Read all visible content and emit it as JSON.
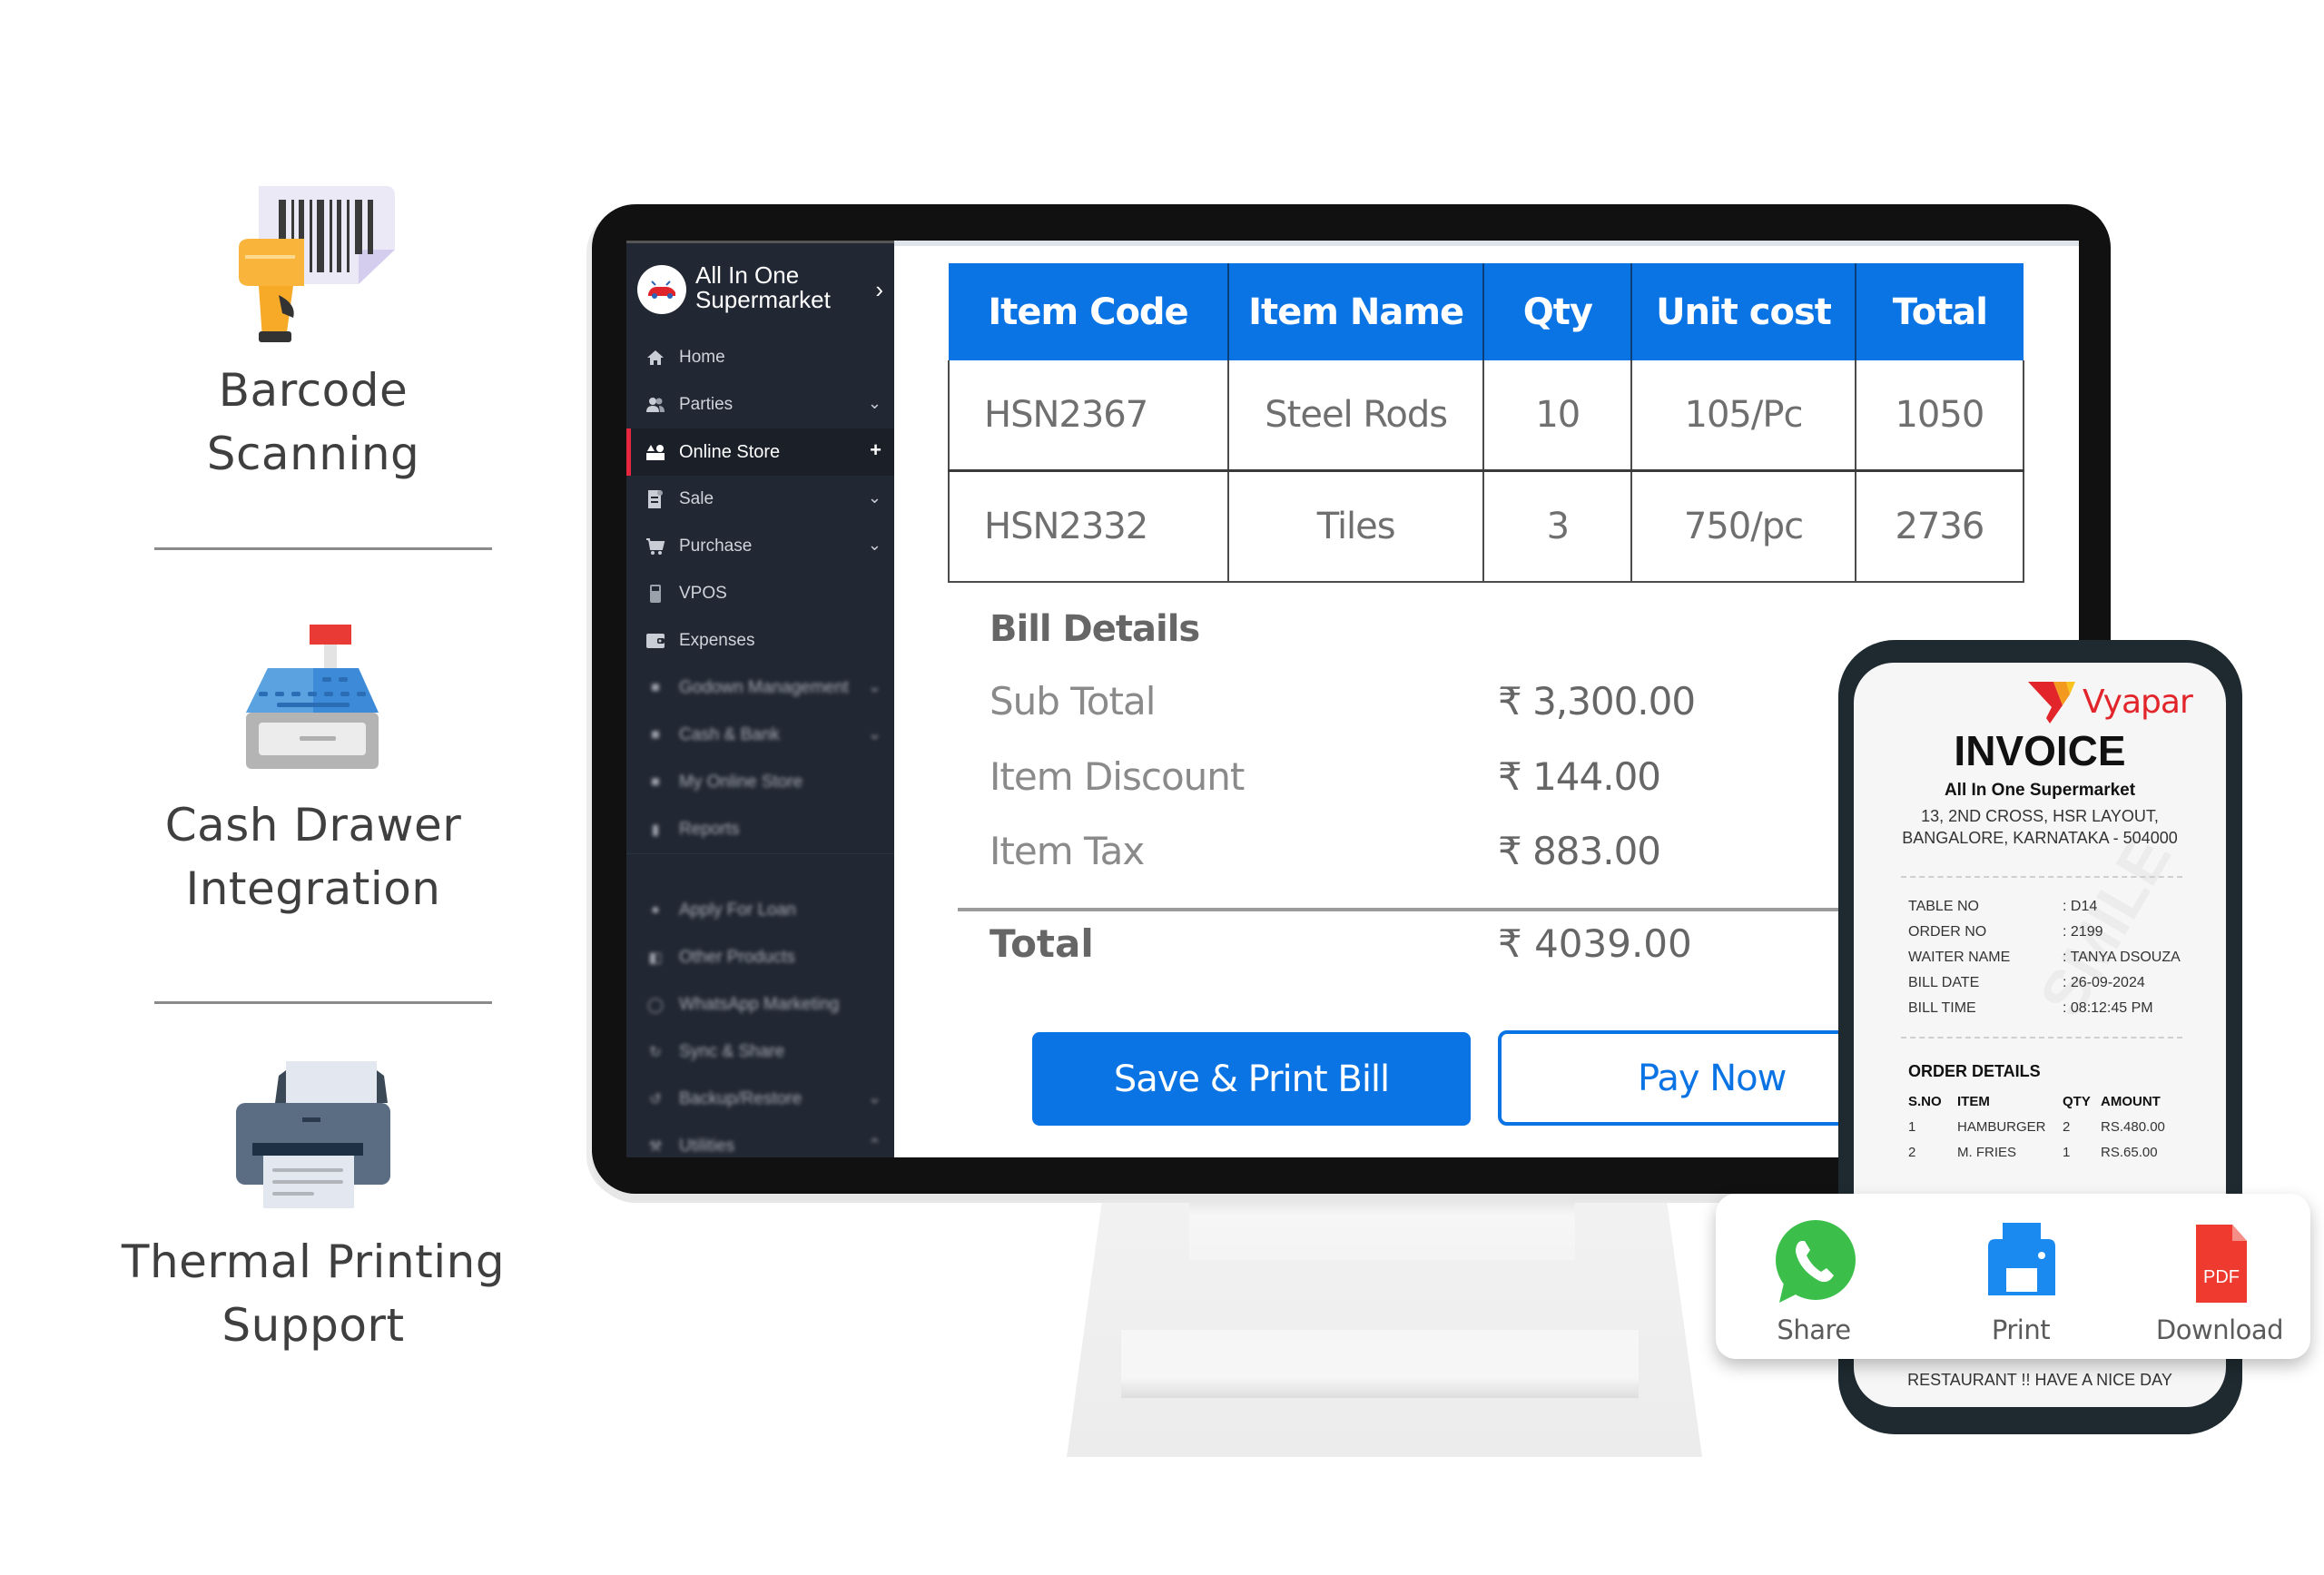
{
  "features": [
    {
      "icon": "barcode-scanner-icon",
      "title_lines": [
        "Barcode",
        "Scanning"
      ]
    },
    {
      "icon": "cash-register-icon",
      "title_lines": [
        "Cash Drawer",
        "Integration"
      ]
    },
    {
      "icon": "printer-icon",
      "title_lines": [
        "Thermal Printing",
        "Support"
      ]
    }
  ],
  "sidebar": {
    "brand_line1": "All In One",
    "brand_line2": "Supermarket",
    "items": [
      {
        "label": "Home",
        "icon": "home-icon",
        "trail": ""
      },
      {
        "label": "Parties",
        "icon": "users-icon",
        "trail": "⌄"
      },
      {
        "label": "Online Store",
        "icon": "store-icon",
        "trail": "+",
        "active": true
      },
      {
        "label": "Sale",
        "icon": "receipt-icon",
        "trail": "⌄"
      },
      {
        "label": "Purchase",
        "icon": "cart-icon",
        "trail": "⌄"
      },
      {
        "label": "VPOS",
        "icon": "pos-terminal-icon",
        "trail": ""
      },
      {
        "label": "Expenses",
        "icon": "wallet-icon",
        "trail": ""
      },
      {
        "label": "Godown Management",
        "icon": "warehouse-icon",
        "trail": "⌄"
      },
      {
        "label": "Cash & Bank",
        "icon": "bank-icon",
        "trail": "⌄"
      },
      {
        "label": "My Online Store",
        "icon": "shop-icon",
        "trail": ""
      },
      {
        "label": "Reports",
        "icon": "chart-icon",
        "trail": ""
      },
      {
        "label": "Apply For Loan",
        "icon": "loan-icon",
        "trail": ""
      },
      {
        "label": "Other Products",
        "icon": "products-icon",
        "trail": ""
      },
      {
        "label": "WhatsApp Marketing",
        "icon": "whatsapp-icon",
        "trail": ""
      },
      {
        "label": "Sync & Share",
        "icon": "sync-icon",
        "trail": ""
      },
      {
        "label": "Backup/Restore",
        "icon": "backup-icon",
        "trail": "⌄"
      },
      {
        "label": "Utilities",
        "icon": "wrench-icon",
        "trail": "⌃"
      }
    ]
  },
  "items_table": {
    "headers": [
      "Item Code",
      "Item Name",
      "Qty",
      "Unit cost",
      "Total"
    ],
    "rows": [
      [
        "HSN2367",
        "Steel Rods",
        "10",
        "105/Pc",
        "1050"
      ],
      [
        "HSN2332",
        "Tiles",
        "3",
        "750/pc",
        "2736"
      ]
    ]
  },
  "bill": {
    "heading": "Bill Details",
    "rows": [
      {
        "label": "Sub Total",
        "amount": "₹ 3,300.00"
      },
      {
        "label": "Item Discount",
        "amount": "₹ 144.00"
      },
      {
        "label": "Item Tax",
        "amount": "₹ 883.00"
      }
    ],
    "total_label": "Total",
    "total_amount": "₹ 4039.00"
  },
  "buttons": {
    "save_print": "Save & Print Bill",
    "pay_now": "Pay Now"
  },
  "receipt": {
    "brand": "Vyapar",
    "title": "INVOICE",
    "store": "All In One Supermarket",
    "address_line1": "13, 2ND CROSS, HSR LAYOUT,",
    "address_line2": "BANGALORE, KARNATAKA - 504000",
    "meta": [
      {
        "label": "TABLE NO",
        "value": ": D14"
      },
      {
        "label": "ORDER NO",
        "value": ": 2199"
      },
      {
        "label": "WAITER NAME",
        "value": ": TANYA DSOUZA"
      },
      {
        "label": "BILL DATE",
        "value": ": 26-09-2024"
      },
      {
        "label": "BILL TIME",
        "value": ": 08:12:45 PM"
      }
    ],
    "order_title": "ORDER DETAILS",
    "order_headers": [
      "S.NO",
      "ITEM",
      "QTY",
      "AMOUNT"
    ],
    "order_rows": [
      [
        "1",
        "HAMBURGER",
        "2",
        "RS.480.00"
      ],
      [
        "2",
        "M. FRIES",
        "1",
        "RS.65.00"
      ]
    ],
    "footer": "RESTAURANT !! HAVE A NICE DAY"
  },
  "share_actions": [
    {
      "label": "Share",
      "icon": "whatsapp-icon"
    },
    {
      "label": "Print",
      "icon": "printer-icon"
    },
    {
      "label": "Download",
      "icon": "pdf-icon",
      "badge": "PDF"
    }
  ],
  "colors": {
    "primary_blue": "#0b74e5",
    "sidebar_bg": "#222833",
    "active_accent": "#e8263f",
    "vyapar_red": "#e2252b",
    "whatsapp_green": "#3bbf4a",
    "pdf_red": "#ee3a2f"
  }
}
